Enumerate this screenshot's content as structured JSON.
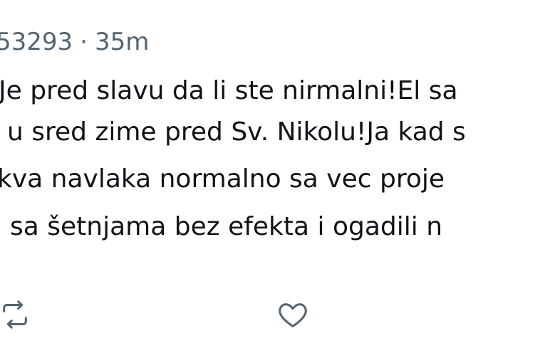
{
  "tweet": {
    "handle_fragment": "53293",
    "separator": "·",
    "time": "35m",
    "lines": [
      "Je pred slavu da li ste nirmalni!El sa",
      "u sred zime pred Sv. Nikolu!Ja kad s",
      "kva navlaka normalno sa vec proje",
      "sa šetnjama bez efekta i ogadili n"
    ]
  },
  "actions": {
    "retweet_icon": "retweet-icon",
    "like_icon": "heart-icon"
  },
  "colors": {
    "text": "#0f1419",
    "muted": "#536471",
    "background": "#ffffff"
  }
}
